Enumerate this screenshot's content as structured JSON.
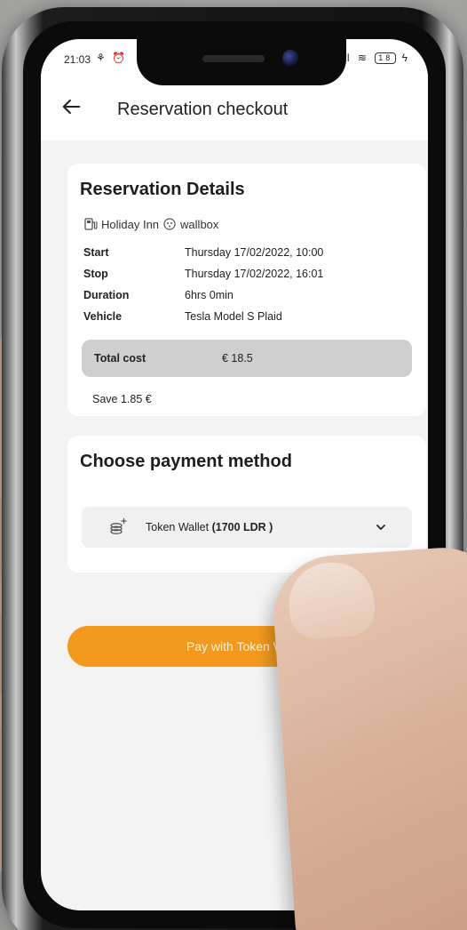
{
  "status_bar": {
    "time": "21:03",
    "left_icons": "⚘ ⏰",
    "right_icons": "ıl ≋",
    "battery": "18",
    "charging": "ϟ"
  },
  "app_bar": {
    "title": "Reservation checkout"
  },
  "reservation": {
    "title": "Reservation Details",
    "location": "Holiday Inn",
    "charger": "wallbox",
    "rows": [
      {
        "label": "Start",
        "value": "Thursday 17/02/2022, 10:00"
      },
      {
        "label": "Stop",
        "value": "Thursday 17/02/2022, 16:01"
      },
      {
        "label": "Duration",
        "value": "6hrs 0min"
      },
      {
        "label": "Vehicle",
        "value": "Tesla Model S Plaid"
      }
    ],
    "total_label": "Total cost",
    "total_value": "€ 18.5",
    "save_text": "Save 1.85 €"
  },
  "payment": {
    "title": "Choose payment method",
    "method_prefix": "Token Wallet ",
    "method_balance": "(1700 LDR )"
  },
  "pay_button": {
    "label": "Pay with Token Wallet"
  },
  "colors": {
    "accent": "#f39a1e",
    "card_bg": "#ffffff",
    "screen_bg": "#f3f3f3",
    "total_bg": "#cfcfcf"
  },
  "icons": [
    "back-arrow-icon",
    "charging-station-icon",
    "plug-icon",
    "wallet-coins-icon",
    "chevron-down-icon"
  ]
}
